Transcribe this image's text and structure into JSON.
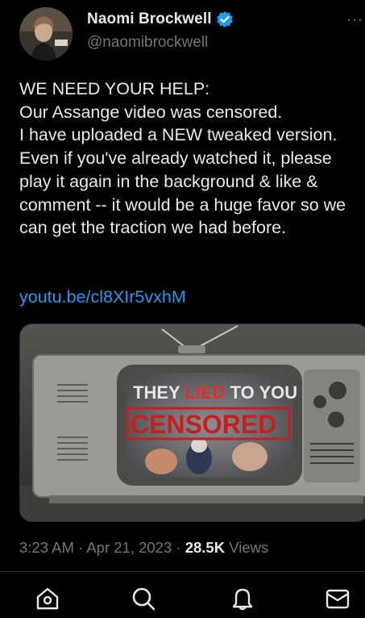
{
  "author": {
    "name": "Naomi Brockwell",
    "handle": "@naomibrockwell"
  },
  "more_label": "···",
  "tweet": {
    "text": "WE NEED YOUR HELP:\nOur Assange video was censored.\nI have uploaded a NEW tweaked version.\nEven if you've already watched it, please play it again in the background & like & comment -- it would be a huge favor so we can get the traction we had before.",
    "link": "youtu.be/cl8XIr5vxhM"
  },
  "media": {
    "overlay_top_a": "THEY ",
    "overlay_top_b": "LIED",
    "overlay_top_c": " TO YOU",
    "overlay_stamp": "CENSORED"
  },
  "meta": {
    "time": "3:23 AM",
    "date": "Apr 21, 2023",
    "separator": " · ",
    "views_count": "28.5K",
    "views_label": "Views"
  },
  "nav": {
    "items": [
      "home-icon",
      "search-icon",
      "notifications-icon",
      "messages-icon"
    ]
  },
  "colors": {
    "background": "#000000",
    "text": "#e7e9ea",
    "secondary": "#71767b",
    "link": "#1d9bf0",
    "verified": "#1d9bf0",
    "stamp_red": "#c81e1e"
  }
}
